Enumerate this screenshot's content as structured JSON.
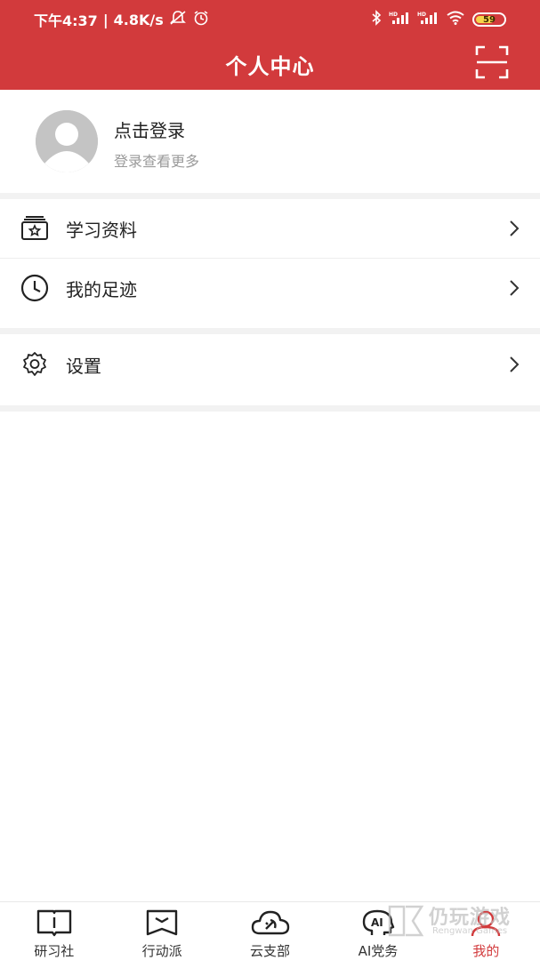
{
  "status_bar": {
    "time": "下午4:37",
    "separator": "|",
    "net_speed": "4.8K/s",
    "battery": "59",
    "icons": [
      "mute-icon",
      "alarm-icon",
      "bluetooth-icon",
      "signal-hd-icon",
      "signal-hd-icon",
      "wifi-icon",
      "battery-icon"
    ]
  },
  "header": {
    "title": "个人中心",
    "scan_icon": "scan-icon",
    "background": "#d23a3c"
  },
  "profile": {
    "login_label": "点击登录",
    "login_sub": "登录查看更多",
    "avatar_icon": "default-avatar-icon"
  },
  "menu": {
    "items": [
      {
        "label": "学习资料",
        "icon": "study-materials-icon"
      },
      {
        "label": "我的足迹",
        "icon": "clock-icon"
      },
      {
        "label": "设置",
        "icon": "gear-icon"
      }
    ]
  },
  "tabbar": {
    "active_color": "#d23a3c",
    "tabs": [
      {
        "label": "研习社",
        "icon": "book-icon"
      },
      {
        "label": "行动派",
        "icon": "banner-icon"
      },
      {
        "label": "云支部",
        "icon": "cloud-party-icon"
      },
      {
        "label": "AI党务",
        "icon": "ai-head-icon"
      },
      {
        "label": "我的",
        "icon": "user-icon",
        "active": true
      }
    ]
  },
  "watermark": {
    "main": "仍玩游戏",
    "sub": "Rengwan Games"
  }
}
